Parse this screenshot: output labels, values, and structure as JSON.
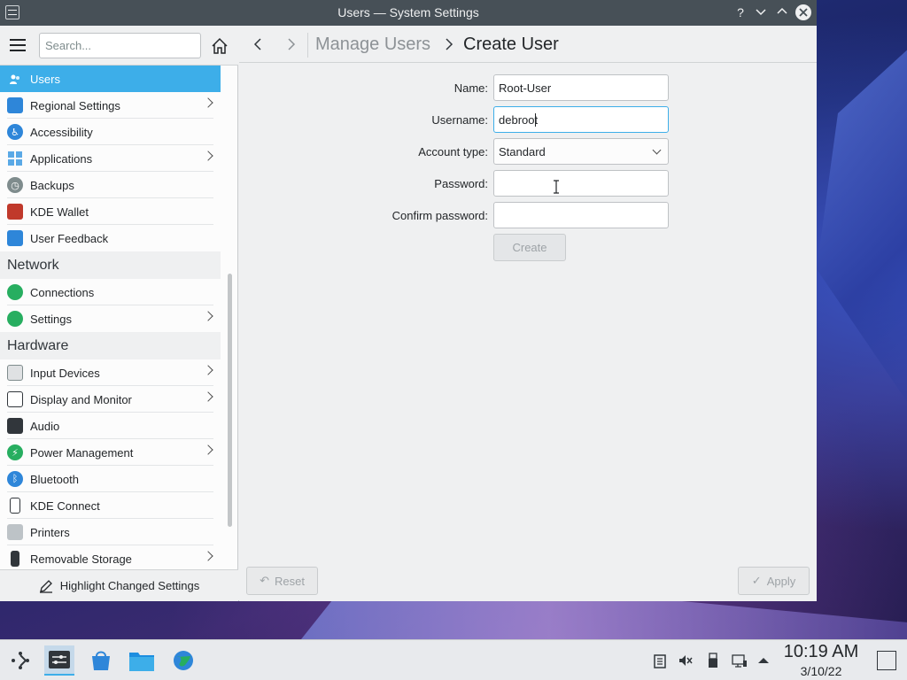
{
  "window": {
    "title": "Users — System Settings",
    "help_glyph": "?",
    "minimize_glyph": "⌄",
    "maximize_glyph": "⌃",
    "close_glyph": "✕"
  },
  "sidebar": {
    "search_placeholder": "Search...",
    "items_top": [
      {
        "label": "Users",
        "icon": "users-icon",
        "selected": true
      },
      {
        "label": "Regional Settings",
        "icon": "regional-icon",
        "chevron": true
      },
      {
        "label": "Accessibility",
        "icon": "accessibility-icon"
      },
      {
        "label": "Applications",
        "icon": "applications-icon",
        "chevron": true
      },
      {
        "label": "Backups",
        "icon": "backups-icon"
      },
      {
        "label": "KDE Wallet",
        "icon": "wallet-icon"
      },
      {
        "label": "User Feedback",
        "icon": "feedback-icon"
      }
    ],
    "category_network": "Network",
    "items_network": [
      {
        "label": "Connections",
        "icon": "globe-icon"
      },
      {
        "label": "Settings",
        "icon": "globe-icon",
        "chevron": true
      }
    ],
    "category_hardware": "Hardware",
    "items_hardware": [
      {
        "label": "Input Devices",
        "icon": "keyboard-icon",
        "chevron": true
      },
      {
        "label": "Display and Monitor",
        "icon": "monitor-icon",
        "chevron": true
      },
      {
        "label": "Audio",
        "icon": "speaker-icon"
      },
      {
        "label": "Power Management",
        "icon": "power-icon",
        "chevron": true
      },
      {
        "label": "Bluetooth",
        "icon": "bluetooth-icon"
      },
      {
        "label": "KDE Connect",
        "icon": "phone-icon"
      },
      {
        "label": "Printers",
        "icon": "printer-icon"
      },
      {
        "label": "Removable Storage",
        "icon": "usb-icon",
        "chevron": true
      }
    ],
    "footer_label": "Highlight Changed Settings"
  },
  "breadcrumb": {
    "parent": "Manage Users",
    "current": "Create User"
  },
  "form": {
    "name_label": "Name:",
    "name_value": "Root-User",
    "username_label": "Username:",
    "username_value": "debroot",
    "account_type_label": "Account type:",
    "account_type_value": "Standard",
    "password_label": "Password:",
    "password_value": "",
    "confirm_label": "Confirm password:",
    "confirm_value": "",
    "create_label": "Create"
  },
  "buttons": {
    "reset_label": "Reset",
    "apply_label": "Apply",
    "reset_glyph": "↶",
    "apply_glyph": "✓"
  },
  "taskbar": {
    "time": "10:19 AM",
    "date": "3/10/22"
  },
  "colors": {
    "accent": "#3daee9",
    "titlebar": "#475057"
  }
}
